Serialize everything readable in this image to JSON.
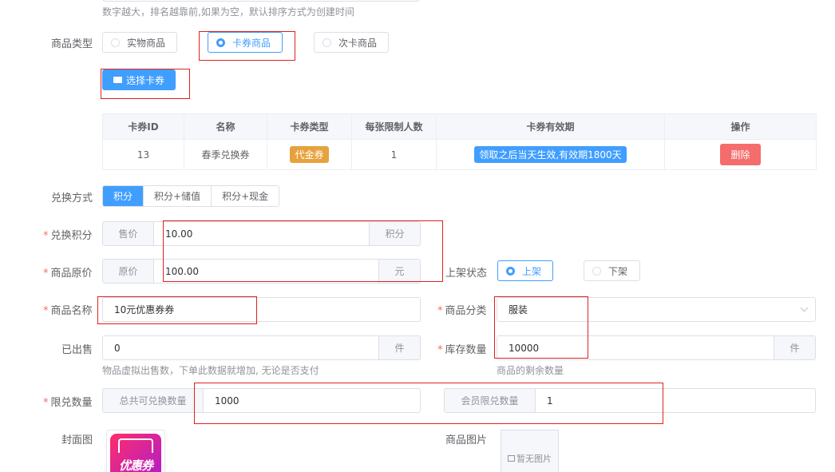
{
  "sort_hint": "数字越大，排名越靠前,如果为空，默认排序方式为创建时间",
  "product_type": {
    "label": "商品类型",
    "options": [
      "实物商品",
      "卡券商品",
      "次卡商品"
    ],
    "selected": "卡券商品"
  },
  "select_card_button": "选择卡券",
  "card_table": {
    "headers": [
      "卡券ID",
      "名称",
      "卡券类型",
      "每张限制人数",
      "卡券有效期",
      "操作"
    ],
    "rows": [
      {
        "id": "13",
        "name": "春季兑换券",
        "type": "代金券",
        "limit": "1",
        "validity": "领取之后当天生效,有效期1800天",
        "action": "删除"
      }
    ]
  },
  "exchange_method": {
    "label": "兑换方式",
    "options": [
      "积分",
      "积分+储值",
      "积分+现金"
    ],
    "selected": "积分"
  },
  "exchange_points": {
    "label": "兑换积分",
    "prefix": "售价",
    "value": "10.00",
    "suffix": "积分"
  },
  "original_price": {
    "label": "商品原价",
    "prefix": "原价",
    "value": "100.00",
    "suffix": "元"
  },
  "shelf_status": {
    "label": "上架状态",
    "options": [
      "上架",
      "下架"
    ],
    "selected": "上架"
  },
  "product_name": {
    "label": "商品名称",
    "value": "10元优惠券券"
  },
  "category": {
    "label": "商品分类",
    "value": "服装"
  },
  "sold": {
    "label": "已出售",
    "value": "0",
    "suffix": "件",
    "hint": "物品虚拟出售数，下单此数据就增加, 无论是否支付"
  },
  "stock": {
    "label": "库存数量",
    "value": "10000",
    "suffix": "件",
    "hint": "商品的剩余数量"
  },
  "limit": {
    "label": "限兑数量",
    "total_prefix": "总共可兑换数量",
    "total_value": "1000",
    "member_prefix": "会员限兑数量",
    "member_value": "1"
  },
  "cover": {
    "label": "封面图",
    "image_text": "优惠券"
  },
  "product_images": {
    "label": "商品图片",
    "empty_text": "暂无图片"
  },
  "colors": {
    "primary": "#409eff",
    "danger": "#f56c6c",
    "warning": "#e6a23c",
    "annotation": "#e02020"
  }
}
